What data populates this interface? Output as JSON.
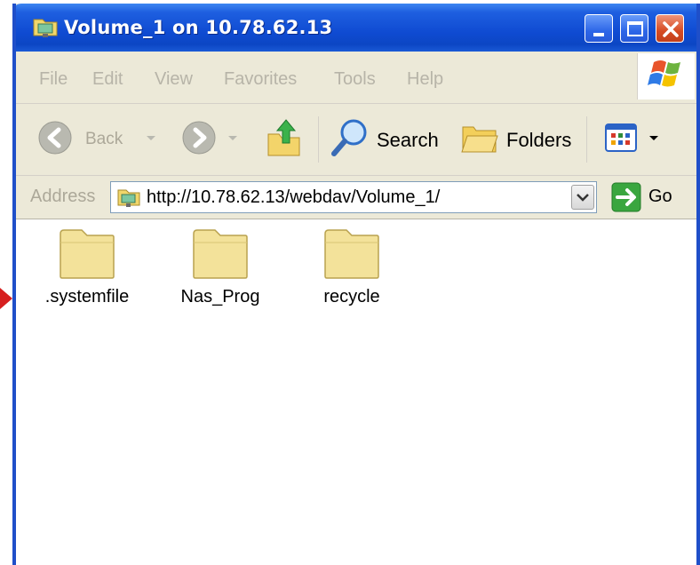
{
  "window": {
    "title": "Volume_1 on 10.78.62.13"
  },
  "menu": {
    "items": [
      "File",
      "Edit",
      "View",
      "Favorites",
      "Tools",
      "Help"
    ]
  },
  "toolbar": {
    "back_label": "Back",
    "search_label": "Search",
    "folders_label": "Folders"
  },
  "address": {
    "label": "Address",
    "url": "http://10.78.62.13/webdav/Volume_1/",
    "go_label": "Go"
  },
  "files": [
    {
      "name": ".systemfile",
      "icon": "folder-icon"
    },
    {
      "name": "Nas_Prog",
      "icon": "folder-icon"
    },
    {
      "name": "recycle",
      "icon": "folder-icon"
    }
  ],
  "colors": {
    "titlebar": "#0f4bd2",
    "chrome": "#ece9d8",
    "close_button": "#d64b23",
    "folder": "#f3e29a"
  }
}
